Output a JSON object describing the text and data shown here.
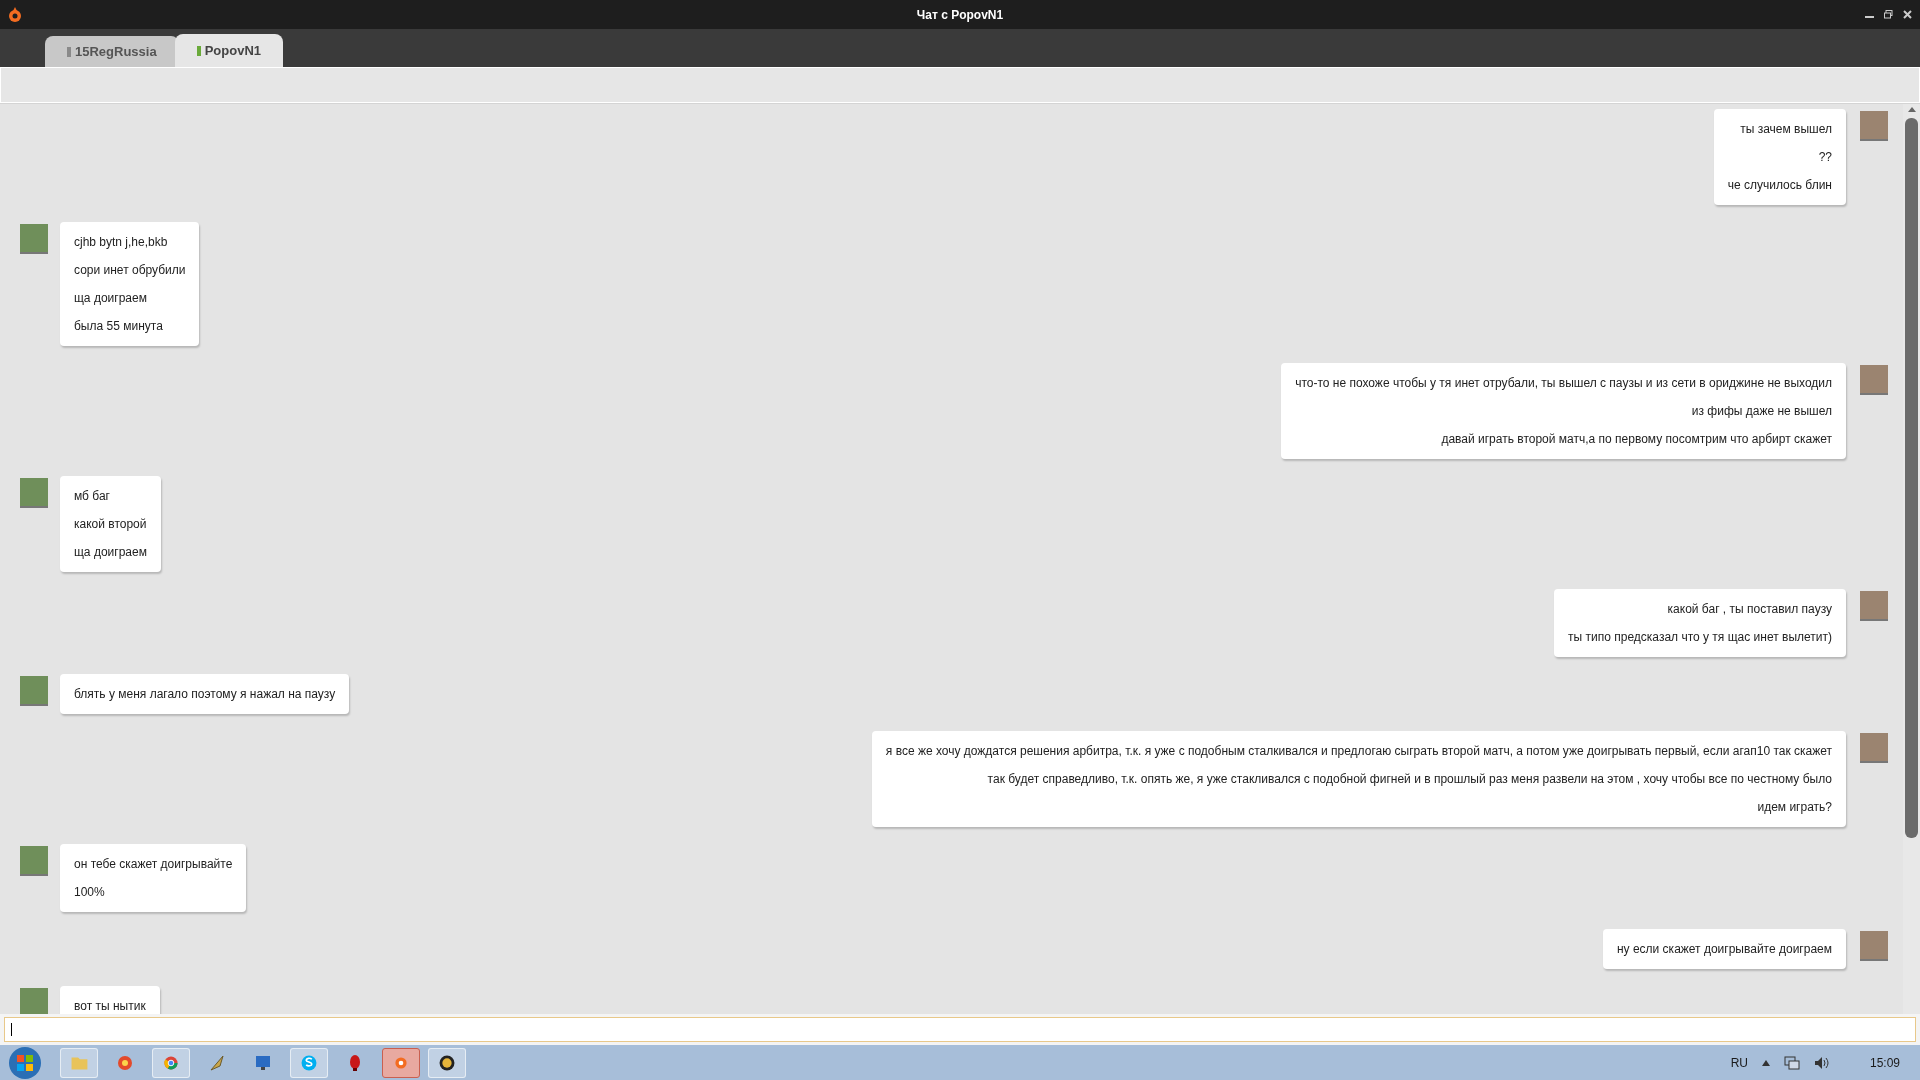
{
  "window": {
    "title": "Чат с PopovN1"
  },
  "tabs": [
    {
      "label": "15RegRussia",
      "selected": false,
      "color": "#8a8a8a"
    },
    {
      "label": "PopovN1",
      "selected": true,
      "color": "#6aaa3a"
    }
  ],
  "messages": [
    {
      "kind": "outgoing",
      "lines": [
        "ты зачем вышел",
        "??",
        "че случилось блин"
      ]
    },
    {
      "kind": "incoming",
      "lines": [
        "cjhb bytn j,he,bkb",
        "сори инет обрубили",
        "ща доиграем",
        "была 55 минута"
      ]
    },
    {
      "kind": "outgoing",
      "lines": [
        "что-то не похоже чтобы у тя инет отрубали, ты вышел с паузы и из сети в ориджине не выходил",
        "из фифы даже не вышел",
        "давай играть второй матч,а по первому посомтрим что арбирт скажет"
      ]
    },
    {
      "kind": "incoming",
      "lines": [
        "мб баг",
        "какой второй",
        "ща доиграем"
      ]
    },
    {
      "kind": "outgoing",
      "lines": [
        "какой баг , ты поставил паузу",
        "ты типо предсказал что у тя щас инет вылетит)"
      ]
    },
    {
      "kind": "incoming",
      "lines": [
        "блять у меня лагало поэтому я нажал на паузу"
      ]
    },
    {
      "kind": "outgoing",
      "lines": [
        "я все же хочу дождатся решения арбитра, т.к. я уже с подобным сталкивался и предлогаю сыграть второй матч, а потом уже доигрывать первый, если агап10 так скажет",
        "так будет справедливо, т.к. опять же, я уже стакливался с подобной фигней и в прошлый раз меня развели на этом , хочу чтобы все по честному было",
        "идем играть?"
      ]
    },
    {
      "kind": "incoming",
      "lines": [
        "он тебе скажет доигрывайте",
        "100%"
      ]
    },
    {
      "kind": "outgoing",
      "lines": [
        "ну если скажет доигрывайте доиграем"
      ]
    },
    {
      "kind": "incoming",
      "lines": [
        "вот ты нытик"
      ]
    }
  ],
  "taskbar": {
    "language": "RU",
    "time": "15:09"
  }
}
